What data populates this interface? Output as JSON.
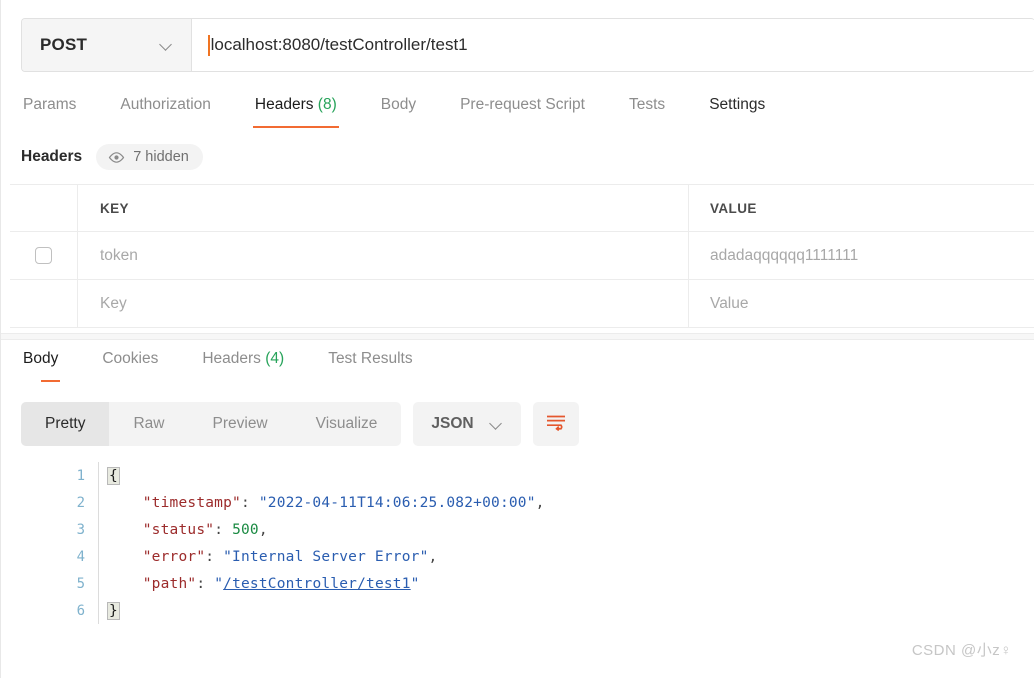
{
  "request": {
    "method": "POST",
    "url": "localhost:8080/testController/test1",
    "tabs": [
      {
        "label": "Params",
        "count": "",
        "active": false
      },
      {
        "label": "Authorization",
        "count": "",
        "active": false
      },
      {
        "label": "Headers",
        "count": "(8)",
        "active": true
      },
      {
        "label": "Body",
        "count": "",
        "active": false
      },
      {
        "label": "Pre-request Script",
        "count": "",
        "active": false
      },
      {
        "label": "Tests",
        "count": "",
        "active": false
      },
      {
        "label": "Settings",
        "count": "",
        "active": false
      }
    ]
  },
  "headers_section": {
    "title": "Headers",
    "hidden_label": "7 hidden",
    "columns": {
      "key": "KEY",
      "value": "VALUE"
    },
    "rows": [
      {
        "key": "token",
        "value": "adadaqqqqqq1111111",
        "checked": false,
        "placeholder": false
      },
      {
        "key": "Key",
        "value": "Value",
        "checked": false,
        "placeholder": true
      }
    ]
  },
  "response": {
    "tabs": [
      {
        "label": "Body",
        "count": "",
        "active": true
      },
      {
        "label": "Cookies",
        "count": "",
        "active": false
      },
      {
        "label": "Headers",
        "count": "(4)",
        "active": false
      },
      {
        "label": "Test Results",
        "count": "",
        "active": false
      }
    ],
    "format_modes": [
      {
        "label": "Pretty",
        "active": true
      },
      {
        "label": "Raw",
        "active": false
      },
      {
        "label": "Preview",
        "active": false
      },
      {
        "label": "Visualize",
        "active": false
      }
    ],
    "language": "JSON",
    "body_lines": [
      {
        "n": "1",
        "tokens": [
          {
            "t": "{",
            "c": "brace"
          }
        ]
      },
      {
        "n": "2",
        "tokens": [
          {
            "t": "    ",
            "c": "k-pun"
          },
          {
            "t": "\"timestamp\"",
            "c": "k-key"
          },
          {
            "t": ": ",
            "c": "k-pun"
          },
          {
            "t": "\"2022-04-11T14:06:25.082+00:00\"",
            "c": "k-str"
          },
          {
            "t": ",",
            "c": "k-pun"
          }
        ]
      },
      {
        "n": "3",
        "tokens": [
          {
            "t": "    ",
            "c": "k-pun"
          },
          {
            "t": "\"status\"",
            "c": "k-key"
          },
          {
            "t": ": ",
            "c": "k-pun"
          },
          {
            "t": "500",
            "c": "k-num"
          },
          {
            "t": ",",
            "c": "k-pun"
          }
        ]
      },
      {
        "n": "4",
        "tokens": [
          {
            "t": "    ",
            "c": "k-pun"
          },
          {
            "t": "\"error\"",
            "c": "k-key"
          },
          {
            "t": ": ",
            "c": "k-pun"
          },
          {
            "t": "\"Internal Server Error\"",
            "c": "k-str"
          },
          {
            "t": ",",
            "c": "k-pun"
          }
        ]
      },
      {
        "n": "5",
        "tokens": [
          {
            "t": "    ",
            "c": "k-pun"
          },
          {
            "t": "\"path\"",
            "c": "k-key"
          },
          {
            "t": ": ",
            "c": "k-pun"
          },
          {
            "t": "\"",
            "c": "k-str"
          },
          {
            "t": "/testController/test1",
            "c": "k-link"
          },
          {
            "t": "\"",
            "c": "k-str"
          }
        ]
      },
      {
        "n": "6",
        "tokens": [
          {
            "t": "}",
            "c": "brace"
          }
        ]
      }
    ]
  },
  "watermark": "CSDN @小z♀",
  "colors": {
    "accent_orange": "#f26b32",
    "count_green": "#27a35a",
    "json_string": "#2a5db0",
    "json_key": "#9c2b2b",
    "json_number": "#1a8a42",
    "gutter_blue": "#7fb2cd"
  }
}
